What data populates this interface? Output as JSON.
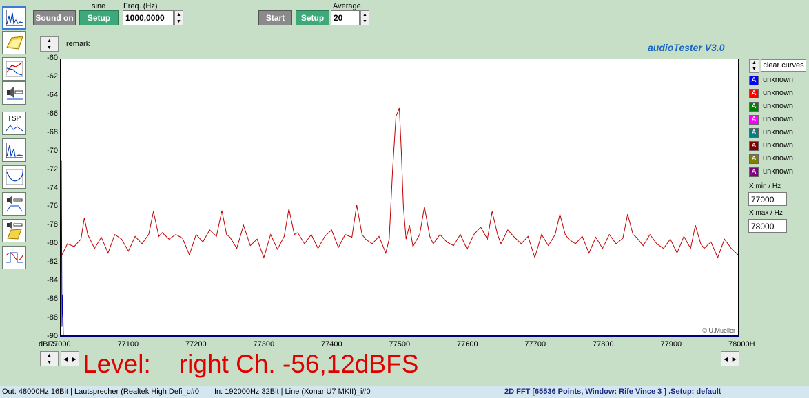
{
  "app": {
    "title": "audioTester  V3.0",
    "credit": "© U.Mueller"
  },
  "top": {
    "signal_label": "sine",
    "sound_on": "Sound on",
    "gen_setup": "Setup",
    "freq_label": "Freq. (Hz)",
    "freq_value": "1000,0000",
    "start": "Start",
    "meas_setup": "Setup",
    "average_label": "Average",
    "average_value": "20"
  },
  "remark_label": "remark",
  "toolbar_icons": [
    "spectrum-icon",
    "folder-icon",
    "response-icon",
    "speaker-icon",
    "tsp-icon",
    "spectrum2-icon",
    "curve-icon",
    "speaker-filter-icon",
    "speaker-folder-icon",
    "scope-icon"
  ],
  "tsp_label": "TSP",
  "legend": {
    "clear_curves": "clear curves",
    "items": [
      {
        "label": "unknown",
        "color": "#0000ff",
        "text_color": "#ffffff"
      },
      {
        "label": "unknown",
        "color": "#ff0000",
        "text_color": "#ffffff"
      },
      {
        "label": "unknown",
        "color": "#008000",
        "text_color": "#ffffff"
      },
      {
        "label": "unknown",
        "color": "#ff00ff",
        "text_color": "#ffffff"
      },
      {
        "label": "unknown",
        "color": "#008080",
        "text_color": "#ffffff"
      },
      {
        "label": "unknown",
        "color": "#800000",
        "text_color": "#ffffff"
      },
      {
        "label": "unknown",
        "color": "#808000",
        "text_color": "#ffffff"
      },
      {
        "label": "unknown",
        "color": "#800080",
        "text_color": "#ffffff"
      }
    ],
    "glyph": "A"
  },
  "xrange": {
    "xmin_label": "X min / Hz",
    "xmin_value": "77000",
    "xmax_label": "X max / Hz",
    "xmax_value": "78000"
  },
  "level_text": "Level:    right Ch. -56,12dBFS",
  "status": {
    "out": "Out: 48000Hz 16Bit  | Lautsprecher (Realtek High Defi_o#0",
    "in": "In: 192000Hz 32Bit  | Line (Xonar U7 MKII)_i#0",
    "fft": "2D FFT [65536 Points, Window: Rife Vince 3 ]  .Setup:  default"
  },
  "chart_data": {
    "type": "line",
    "xlabel": "",
    "ylabel": "dBFS",
    "xlim": [
      77000,
      78000
    ],
    "ylim": [
      -90,
      -60
    ],
    "x_unit_suffix": "H",
    "xticks": [
      77000,
      77100,
      77200,
      77300,
      77400,
      77500,
      77600,
      77700,
      77800,
      77900,
      78000
    ],
    "yticks": [
      -60,
      -62,
      -64,
      -66,
      -68,
      -70,
      -72,
      -74,
      -76,
      -78,
      -80,
      -82,
      -84,
      -86,
      -88,
      -90
    ],
    "grid": false,
    "series": [
      {
        "color": "#c00000",
        "x": [
          77000,
          77010,
          77020,
          77030,
          77035,
          77040,
          77050,
          77060,
          77070,
          77080,
          77090,
          77100,
          77110,
          77120,
          77130,
          77137,
          77145,
          77150,
          77160,
          77170,
          77180,
          77190,
          77200,
          77210,
          77220,
          77230,
          77238,
          77245,
          77250,
          77260,
          77270,
          77280,
          77290,
          77300,
          77310,
          77320,
          77330,
          77337,
          77345,
          77350,
          77360,
          77370,
          77380,
          77390,
          77400,
          77410,
          77420,
          77430,
          77437,
          77445,
          77450,
          77460,
          77470,
          77480,
          77485,
          77490,
          77495,
          77500,
          77503,
          77506,
          77510,
          77515,
          77520,
          77530,
          77537,
          77545,
          77550,
          77560,
          77570,
          77580,
          77590,
          77600,
          77610,
          77620,
          77630,
          77637,
          77645,
          77650,
          77660,
          77670,
          77680,
          77690,
          77700,
          77710,
          77720,
          77730,
          77737,
          77745,
          77750,
          77760,
          77770,
          77780,
          77790,
          77800,
          77810,
          77820,
          77830,
          77837,
          77845,
          77850,
          77860,
          77870,
          77880,
          77890,
          77900,
          77910,
          77920,
          77930,
          77937,
          77945,
          77950,
          77960,
          77970,
          77980,
          77990,
          78000
        ],
        "y": [
          -81.5,
          -80.0,
          -80.3,
          -79.5,
          -77.2,
          -79.0,
          -80.5,
          -79.3,
          -81.0,
          -79.0,
          -79.5,
          -80.8,
          -79.2,
          -80.0,
          -79.0,
          -76.5,
          -79.2,
          -78.8,
          -79.5,
          -79.0,
          -79.4,
          -81.2,
          -79.0,
          -79.8,
          -78.5,
          -79.2,
          -76.4,
          -79.0,
          -79.3,
          -80.5,
          -78.0,
          -80.2,
          -79.5,
          -81.5,
          -79.0,
          -80.6,
          -79.2,
          -76.2,
          -79.0,
          -78.8,
          -80.0,
          -79.0,
          -80.5,
          -79.2,
          -78.5,
          -80.4,
          -79.0,
          -79.3,
          -75.8,
          -79.0,
          -79.5,
          -80.0,
          -79.2,
          -81.0,
          -79.5,
          -72.0,
          -66.2,
          -65.3,
          -70.0,
          -76.0,
          -79.5,
          -78.0,
          -80.3,
          -79.0,
          -76.0,
          -79.2,
          -80.0,
          -79.0,
          -79.8,
          -80.2,
          -79.0,
          -80.6,
          -79.0,
          -78.2,
          -79.5,
          -76.5,
          -79.0,
          -80.0,
          -78.5,
          -79.3,
          -80.0,
          -79.2,
          -81.5,
          -79.0,
          -80.2,
          -79.0,
          -76.8,
          -79.0,
          -79.5,
          -80.0,
          -79.2,
          -81.0,
          -79.3,
          -80.5,
          -79.0,
          -80.0,
          -79.4,
          -76.8,
          -79.0,
          -79.3,
          -80.2,
          -79.0,
          -80.0,
          -80.5,
          -79.5,
          -81.0,
          -79.2,
          -80.5,
          -78.0,
          -80.0,
          -80.5,
          -79.8,
          -81.5,
          -79.5,
          -80.5,
          -81.2
        ]
      },
      {
        "color": "#0000c0",
        "x": [
          77000,
          77001,
          77002,
          77003,
          77004
        ],
        "y": [
          -90,
          -71,
          -89,
          -85.5,
          -90
        ]
      }
    ]
  }
}
